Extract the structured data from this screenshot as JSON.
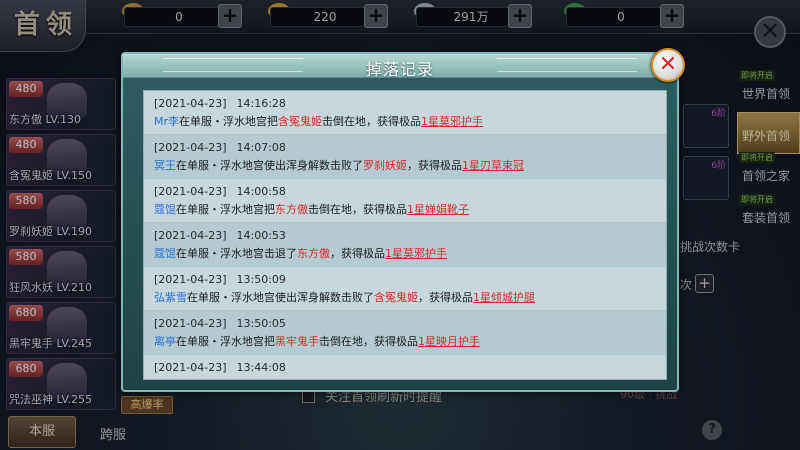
{
  "header": {
    "logo_text": "首领",
    "resources": [
      {
        "name": "coin",
        "value": "0",
        "icon": "coin-icon",
        "color": "#c79a3c"
      },
      {
        "name": "gold-ingot",
        "value": "220",
        "icon": "gold-ingot-icon",
        "color": "#d9a92e"
      },
      {
        "name": "silver-ingot",
        "value": "291万",
        "icon": "silver-ingot-icon",
        "color": "#b9bcc2"
      },
      {
        "name": "jade",
        "value": "0",
        "icon": "jade-icon",
        "color": "#3aa25a"
      }
    ],
    "add_label": "+",
    "close_label": "✕"
  },
  "boss_list": [
    {
      "cost": "480",
      "name": "东方傲 LV.130"
    },
    {
      "cost": "480",
      "name": "含冤鬼姬 LV.150"
    },
    {
      "cost": "580",
      "name": "罗刹妖姬 LV.190"
    },
    {
      "cost": "580",
      "name": "狂风水妖 LV.210"
    },
    {
      "cost": "680",
      "name": "黑牢鬼手 LV.245"
    },
    {
      "cost": "680",
      "name": "咒法巫神 LV.255"
    }
  ],
  "boss_tag": "高爆率",
  "server_tabs": {
    "local": "本服",
    "cross": "跨服"
  },
  "right_nav": [
    {
      "badge": "即将开启",
      "label": "世界首领",
      "active": false
    },
    {
      "badge": "",
      "label": "野外首领",
      "active": true
    },
    {
      "badge": "即将开启",
      "label": "首领之家",
      "active": false
    },
    {
      "badge": "即将开启",
      "label": "套装首领",
      "active": false
    }
  ],
  "side": {
    "item_rank_1": "6阶",
    "item_rank_2": "6阶",
    "challenge_card": "挑战次数卡",
    "times_label": "次",
    "plus": "+",
    "bottom_text": "90级 · 挑战"
  },
  "follow_text": "关注首领刷新时提醒",
  "help_label": "?",
  "modal": {
    "title": "掉落记录",
    "close_label": "✕",
    "entries": [
      {
        "date": "[2021-04-23]",
        "time": "14:16:28",
        "player": "Mr李",
        "pre": "在单服・浮水地宫把",
        "boss": "含冤鬼姬",
        "mid": "击倒在地，获得极品",
        "item": "1星莫邪护手"
      },
      {
        "date": "[2021-04-23]",
        "time": "14:07:08",
        "player": "冥王",
        "pre": "在单服・浮水地宫使出浑身解数击败了",
        "boss": "罗刹妖姬",
        "mid": "，获得极品",
        "item": "1星刃草束冠"
      },
      {
        "date": "[2021-04-23]",
        "time": "14:00:58",
        "player": "蔻馄",
        "pre": "在单服・浮水地宫把",
        "boss": "东方傲",
        "mid": "击倒在地，获得极品",
        "item": "1星婵娟靴子"
      },
      {
        "date": "[2021-04-23]",
        "time": "14:00:53",
        "player": "蔻馄",
        "pre": "在单服・浮水地宫击退了",
        "boss": "东方傲",
        "mid": "，获得极品",
        "item": "1星莫邪护手"
      },
      {
        "date": "[2021-04-23]",
        "time": "13:50:09",
        "player": "弘紫雪",
        "pre": "在单服・浮水地宫使出浑身解数击败了",
        "boss": "含冤鬼姬",
        "mid": "，获得极品",
        "item": "1星倾城护腿"
      },
      {
        "date": "[2021-04-23]",
        "time": "13:50:05",
        "player": "离亭",
        "pre": "在单服・浮水地宫把",
        "boss": "黑牢鬼手",
        "mid": "击倒在地，获得极品",
        "item": "1星映月护手"
      },
      {
        "date": "[2021-04-23]",
        "time": "13:44:08",
        "player": "",
        "pre": "",
        "boss": "",
        "mid": "",
        "item": ""
      }
    ]
  }
}
